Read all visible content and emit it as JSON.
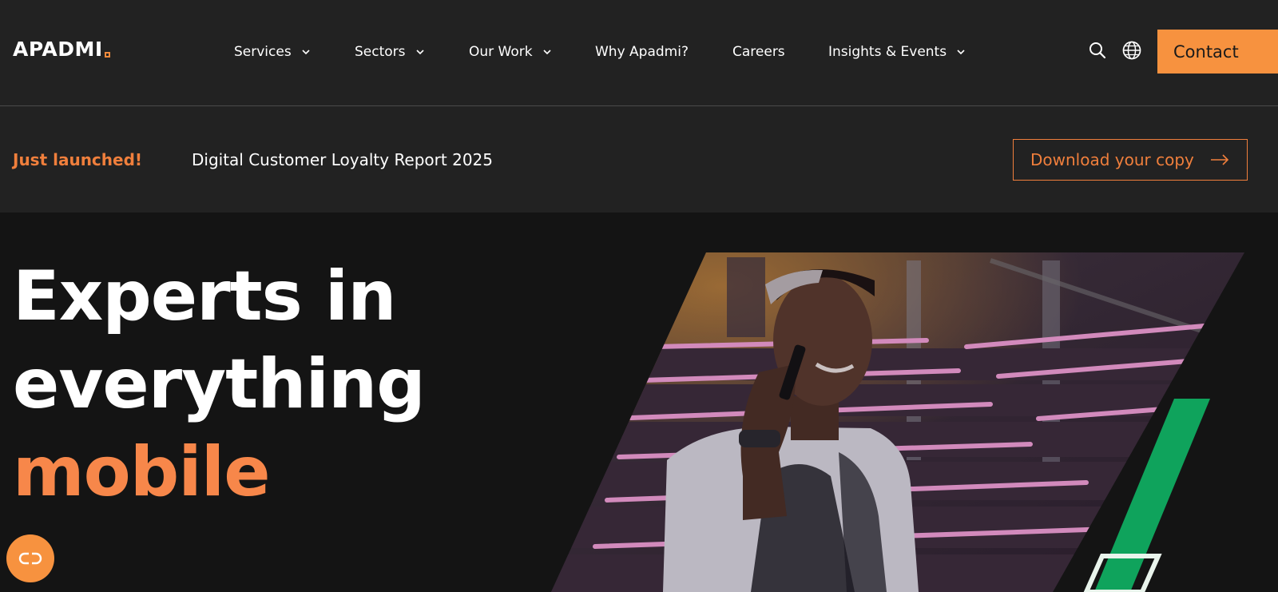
{
  "header": {
    "logo_text": "APADMI",
    "nav": [
      {
        "label": "Services",
        "has_dropdown": true
      },
      {
        "label": "Sectors",
        "has_dropdown": true
      },
      {
        "label": "Our Work",
        "has_dropdown": true
      },
      {
        "label": "Why Apadmi?",
        "has_dropdown": false
      },
      {
        "label": "Careers",
        "has_dropdown": false
      },
      {
        "label": "Insights & Events",
        "has_dropdown": true
      }
    ],
    "icons": [
      "search-icon",
      "globe-icon"
    ],
    "contact_label": "Contact"
  },
  "announcement": {
    "tag": "Just launched!",
    "title": "Digital Customer Loyalty Report 2025",
    "cta_label": "Download your copy"
  },
  "hero": {
    "headline_line1": "Experts in",
    "headline_line2": "everything",
    "headline_line3": "mobile"
  },
  "colors": {
    "accent": "#f7923f",
    "accent_text": "#f07f3c",
    "background": "#141414",
    "header_bg": "#222222",
    "green_stripe": "#0fa35c"
  }
}
